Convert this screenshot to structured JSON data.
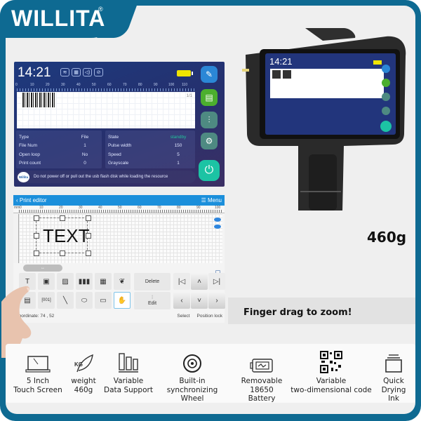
{
  "brand": {
    "name": "WILLITA",
    "reg_mark": "®"
  },
  "device_screen": {
    "time": "14:21",
    "status_icons": [
      "wifi-off-icon",
      "grid-icon",
      "volume-icon",
      "no-print-icon"
    ],
    "battery_color": "#f1e400",
    "ruler_ticks": [
      "0",
      "10",
      "20",
      "30",
      "40",
      "50",
      "60",
      "70",
      "80",
      "90",
      "100",
      "110"
    ],
    "page_indicator": "1/1",
    "left_table": [
      {
        "label": "Type",
        "value": "File"
      },
      {
        "label": "File Num",
        "value": "1"
      },
      {
        "label": "Open loop",
        "value": "No"
      },
      {
        "label": "Print count",
        "value": "0"
      }
    ],
    "right_table": [
      {
        "label": "State",
        "value": "standby"
      },
      {
        "label": "Pulse width",
        "value": "150"
      },
      {
        "label": "Speed",
        "value": "5"
      },
      {
        "label": "Grayscale",
        "value": "1"
      }
    ],
    "state_color": "#22c39a",
    "message_logo": "Willita",
    "message": "Do not power off or pull out the usb flash disk while loading the resource",
    "side_buttons": [
      {
        "name": "edit",
        "color": "#2b87d6"
      },
      {
        "name": "file-preview",
        "color": "#4caf2e"
      },
      {
        "name": "adjust",
        "color": "#4e8a82"
      },
      {
        "name": "settings",
        "color": "#4e8a82"
      },
      {
        "name": "power",
        "color": "#1cc3a4"
      }
    ]
  },
  "print_editor": {
    "back_label": "Print editor",
    "menu_label": "Menu",
    "ruler_unit": "mm",
    "ruler_ticks": [
      "0",
      "10",
      "20",
      "30",
      "40",
      "50",
      "60",
      "70",
      "80",
      "90",
      "100"
    ],
    "text_element": "TEXT",
    "scroll_label": "↔",
    "toolbar_row1": [
      "text-icon",
      "date-icon",
      "image-icon",
      "barcode-icon",
      "qrcode-icon",
      "graphic-icon"
    ],
    "toolbar_row2": [
      "table-icon",
      "counter-icon",
      "line-icon",
      "ellipse-icon",
      "rectangle-icon",
      "hand-icon"
    ],
    "delete_label": "Delete",
    "edit_label": "Edit",
    "coordinates_label": "Coordinate:",
    "coordinates_value": "74 , 52",
    "select_label": "Select",
    "position_lock_label": "Position lock"
  },
  "product": {
    "weight": "460g",
    "zoom_caption": "Finger drag to zoom!"
  },
  "features": [
    {
      "icon": "laptop-screen-icon",
      "line1": "5 Inch",
      "line2": "Touch Screen"
    },
    {
      "icon": "feather-weight-icon",
      "line1": "weight",
      "line2": "460g"
    },
    {
      "icon": "bar-columns-icon",
      "line1": "Variable",
      "line2": "Data Support"
    },
    {
      "icon": "wheel-icon",
      "line1": "Built-in",
      "line2": "synchronizing Wheel"
    },
    {
      "icon": "battery-icon",
      "line1": "Removable",
      "line2": "18650 Battery"
    },
    {
      "icon": "qr-code-icon",
      "line1": "Variable",
      "line2": "two-dimensional code"
    },
    {
      "icon": "ink-cartridge-icon",
      "line1": "Quick",
      "line2": "Drying Ink"
    }
  ],
  "colors": {
    "frame": "#0e6a92",
    "editor_bar": "#1b8fdb"
  }
}
